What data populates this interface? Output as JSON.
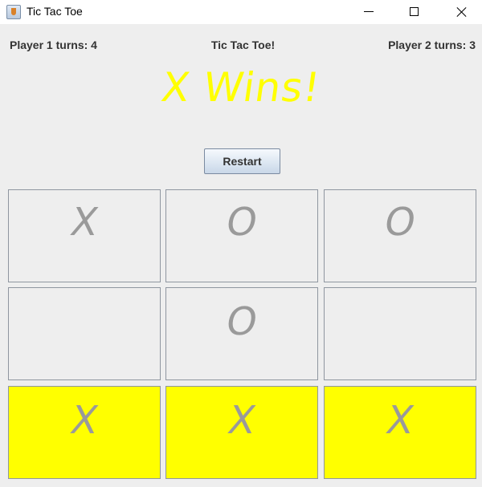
{
  "window": {
    "title": "Tic Tac Toe"
  },
  "header": {
    "player1_turns": "Player 1 turns: 4",
    "game_title": "Tic Tac Toe!",
    "player2_turns": "Player 2 turns: 3"
  },
  "result": "X Wins!",
  "restart_label": "Restart",
  "board": {
    "cells": [
      "X",
      "O",
      "O",
      "",
      "O",
      "",
      "X",
      "X",
      "X"
    ],
    "winning_line": [
      6,
      7,
      8
    ],
    "highlight_color": "#ffff00",
    "mark_color": "#9a9a9a"
  },
  "colors": {
    "result": "#ffff00",
    "background": "#eeeeee"
  }
}
